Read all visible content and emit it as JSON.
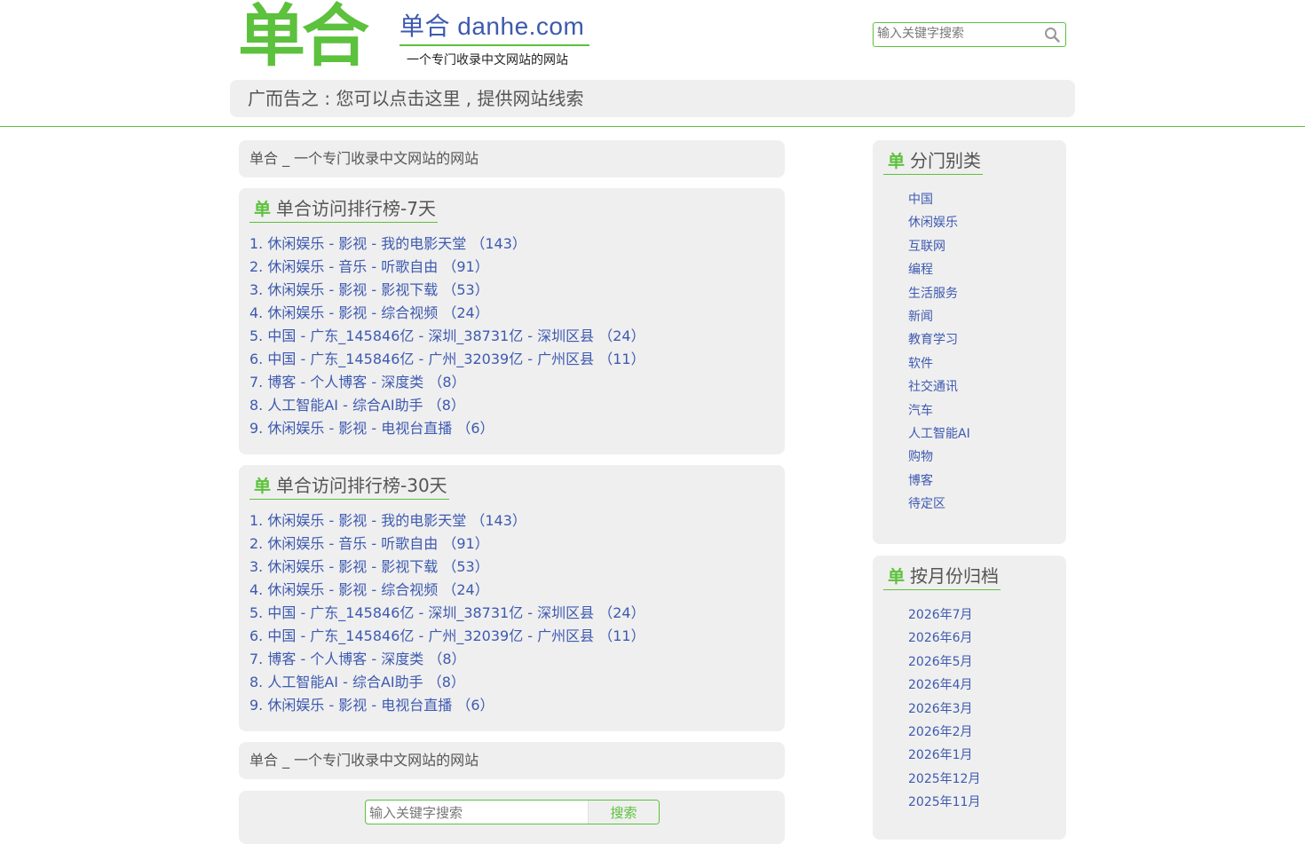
{
  "header": {
    "logo_text": "单合",
    "site_title": "单合 danhe.com",
    "subtitle": "一个专门收录中文网站的网站",
    "search_placeholder": "输入关键字搜索",
    "ad_text": "广而告之 : 您可以点击这里 , 提供网站线索"
  },
  "main": {
    "tagline": "单合 _ 一个专门收录中文网站的网站",
    "tagline_bottom": "单合 _ 一个专门收录中文网站的网站",
    "rank7": {
      "mark": "单",
      "title": "单合访问排行榜-7天",
      "items": [
        "1. 休闲娱乐 - 影视 - 我的电影天堂 （143）",
        "2. 休闲娱乐 - 音乐 - 听歌自由 （91）",
        "3. 休闲娱乐 - 影视 - 影视下载 （53）",
        "4. 休闲娱乐 - 影视 - 综合视频 （24）",
        "5. 中国 - 广东_145846亿 - 深圳_38731亿 - 深圳区县 （24）",
        "6. 中国 - 广东_145846亿 - 广州_32039亿 - 广州区县 （11）",
        "7. 博客 - 个人博客 - 深度类 （8）",
        "8. 人工智能AI - 综合AI助手 （8）",
        "9. 休闲娱乐 - 影视 - 电视台直播 （6）"
      ]
    },
    "rank30": {
      "mark": "单",
      "title": "单合访问排行榜-30天",
      "items": [
        "1. 休闲娱乐 - 影视 - 我的电影天堂 （143）",
        "2. 休闲娱乐 - 音乐 - 听歌自由 （91）",
        "3. 休闲娱乐 - 影视 - 影视下载 （53）",
        "4. 休闲娱乐 - 影视 - 综合视频 （24）",
        "5. 中国 - 广东_145846亿 - 深圳_38731亿 - 深圳区县 （24）",
        "6. 中国 - 广东_145846亿 - 广州_32039亿 - 广州区县 （11）",
        "7. 博客 - 个人博客 - 深度类 （8）",
        "8. 人工智能AI - 综合AI助手 （8）",
        "9. 休闲娱乐 - 影视 - 电视台直播 （6）"
      ]
    },
    "bottom_search": {
      "placeholder": "输入关键字搜索",
      "button": "搜索"
    }
  },
  "sidebar": {
    "categories": {
      "mark": "单",
      "title": "分门别类",
      "items": [
        "中国",
        "休闲娱乐",
        "互联网",
        "编程",
        "生活服务",
        "新闻",
        "教育学习",
        "软件",
        "社交通讯",
        "汽车",
        "人工智能AI",
        "购物",
        "博客",
        "待定区"
      ]
    },
    "archive": {
      "mark": "单",
      "title": "按月份归档",
      "items": [
        "2026年7月",
        "2026年6月",
        "2026年5月",
        "2026年4月",
        "2026年3月",
        "2026年2月",
        "2026年1月",
        "2025年12月",
        "2025年11月"
      ]
    }
  },
  "colors": {
    "brand_green": "#5cc13c",
    "link_blue": "#3d5ab0",
    "panel_gray": "#efefef"
  }
}
